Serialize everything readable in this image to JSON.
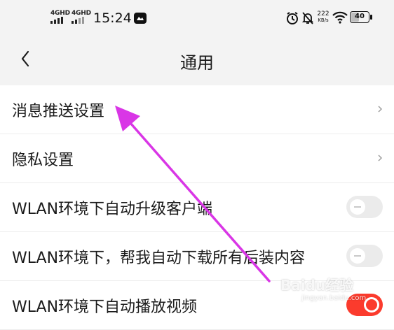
{
  "status_bar": {
    "network_1": "4GHD",
    "network_2": "4GHD",
    "time": "15:24",
    "speed_value": "222",
    "speed_unit": "KB/s",
    "battery": "40"
  },
  "header": {
    "title": "通用"
  },
  "settings": [
    {
      "label": "消息推送设置",
      "control": "chevron"
    },
    {
      "label": "隐私设置",
      "control": "chevron"
    },
    {
      "label": "WLAN环境下自动升级客户端",
      "control": "toggle",
      "on": false
    },
    {
      "label": "WLAN环境下，帮我自动下载所有后装内容",
      "control": "toggle",
      "on": false
    },
    {
      "label": "WLAN环境下自动播放视频",
      "control": "toggle",
      "on": true
    }
  ],
  "colors": {
    "accent": "#fb3b2d",
    "annotation_arrow": "#d936e6"
  },
  "watermark": {
    "brand": "Baidu经验",
    "site": "jingyan.baidu.com"
  }
}
